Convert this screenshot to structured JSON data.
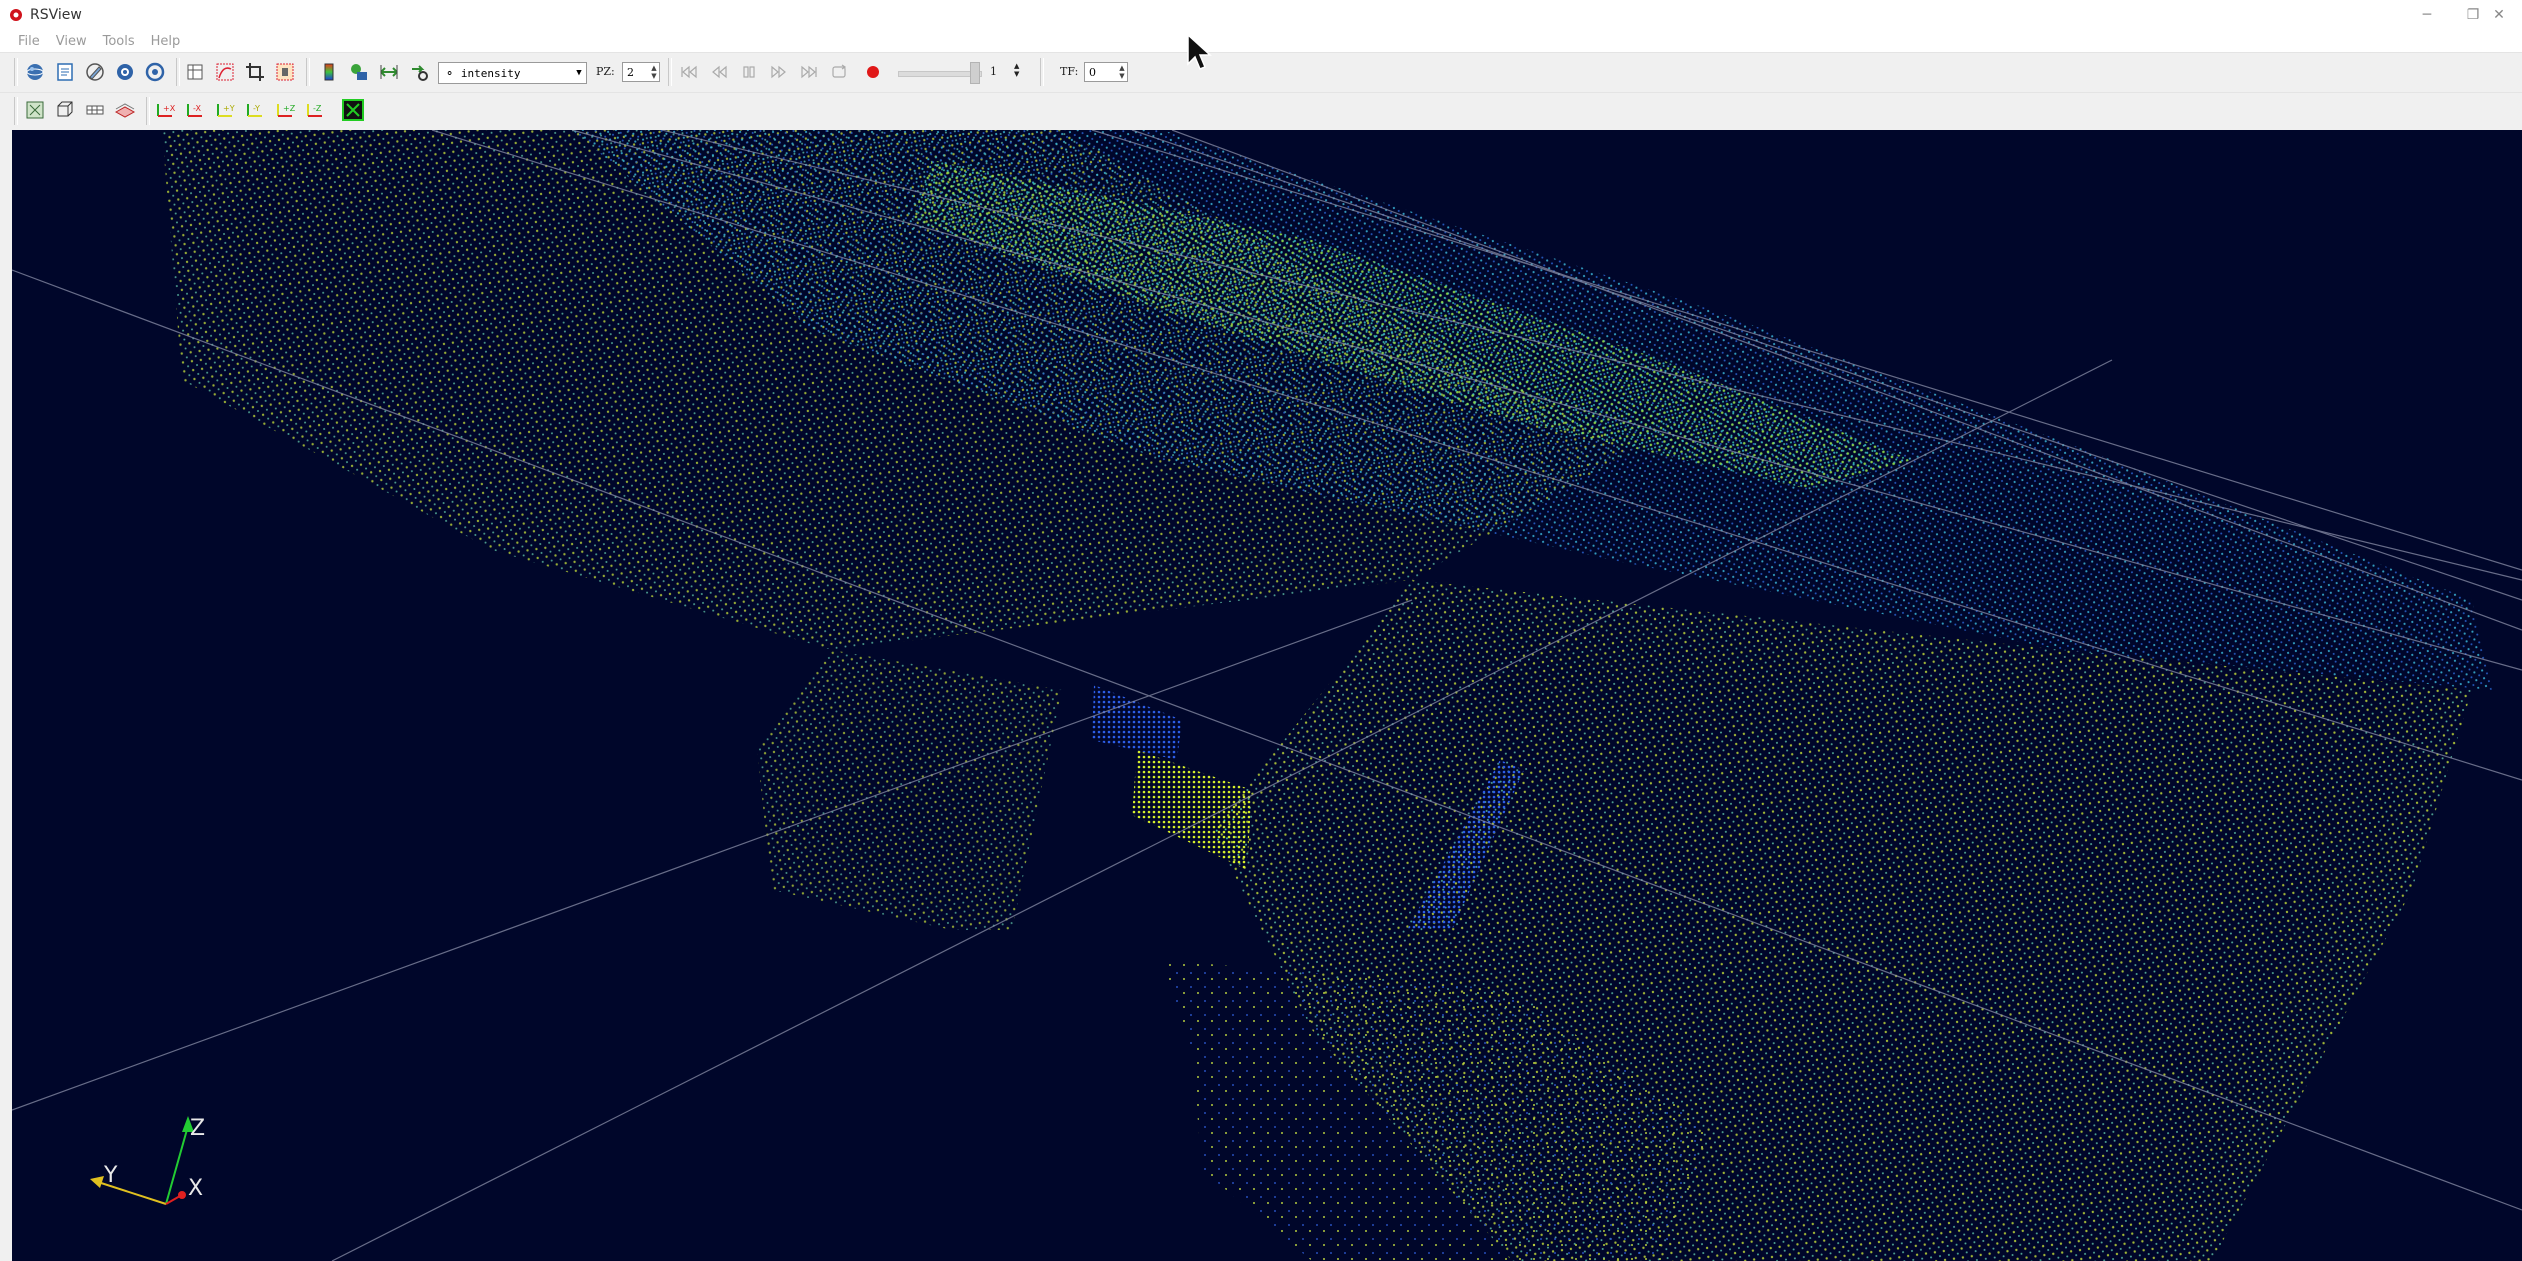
{
  "app": {
    "title": "RSView",
    "window_controls": {
      "minimize": "─",
      "restore": "❐",
      "close": "✕"
    }
  },
  "menu": [
    "File",
    "View",
    "Tools",
    "Help"
  ],
  "toolbar": {
    "color_by": "⚬ intensity",
    "ps_label": "PZ:",
    "ps_value": "2",
    "frame_value": "1",
    "tf_label": "TF:",
    "tf_value": "0"
  },
  "axes": {
    "z": "Z",
    "y": "Y",
    "x": "X"
  },
  "colors": {
    "background": "#00062a",
    "axis_z": "#22cc33",
    "axis_y": "#e0c020",
    "axis_x": "#e02020",
    "record": "#e01818"
  }
}
